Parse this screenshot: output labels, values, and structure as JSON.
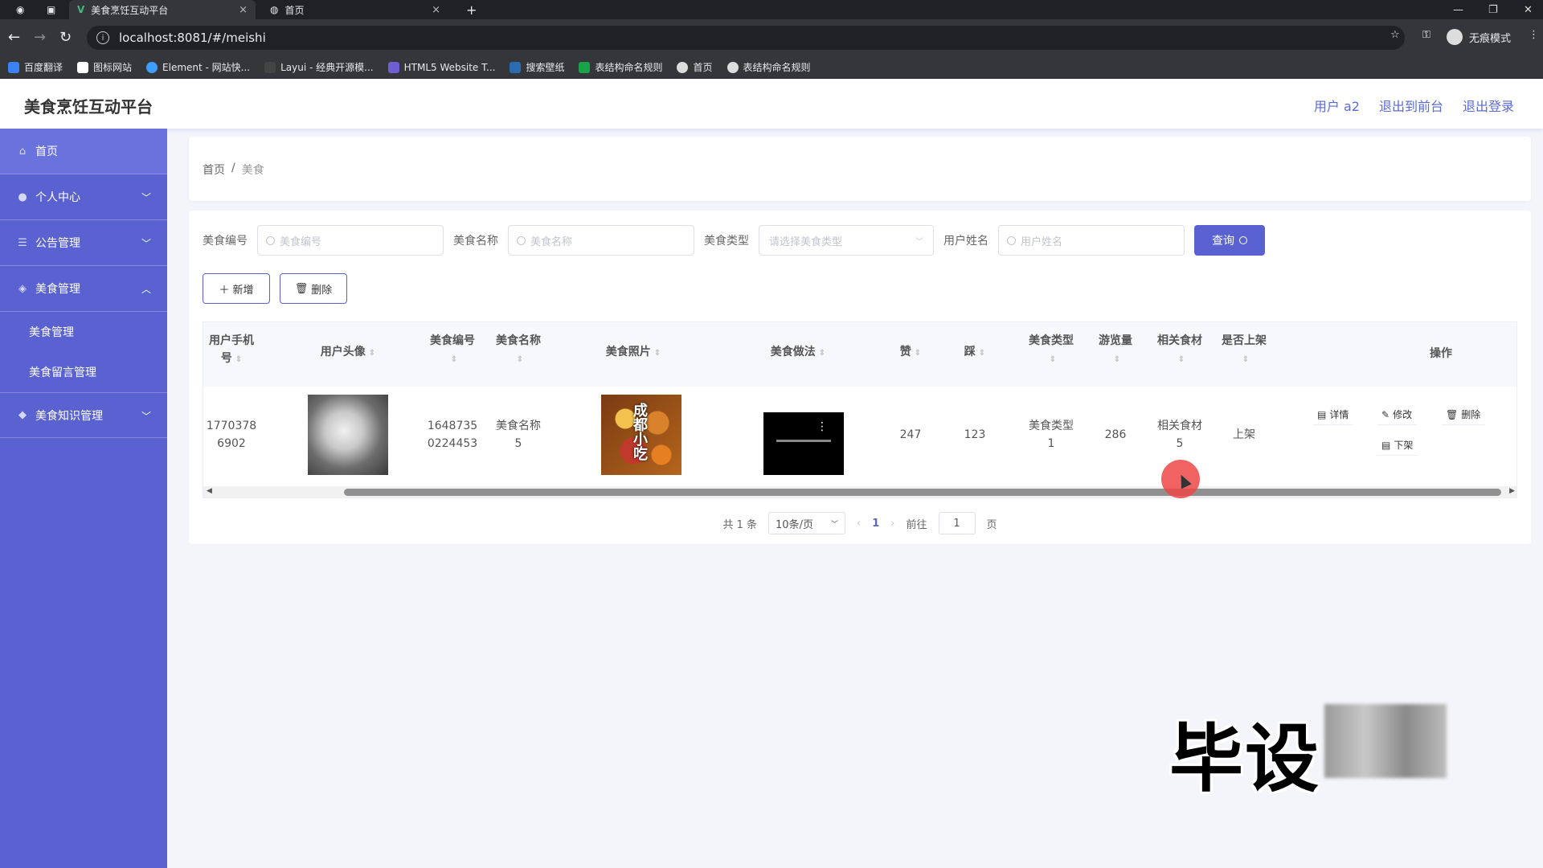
{
  "browser": {
    "tabs": [
      {
        "title": "美食烹饪互动平台",
        "active": true
      },
      {
        "title": "首页",
        "active": false
      }
    ],
    "url": "localhost:8081/#/meishi",
    "profile_label": "无痕模式",
    "bookmarks": [
      "百度翻译",
      "图标网站",
      "Element - 网站快...",
      "Layui - 经典开源模...",
      "HTML5 Website T...",
      "搜索壁纸",
      "表结构命名规则",
      "首页",
      "表结构命名规则"
    ]
  },
  "header": {
    "title": "美食烹饪互动平台",
    "user": "用户 a2",
    "back_front": "退出到前台",
    "logout": "退出登录"
  },
  "sidebar": {
    "items": [
      {
        "label": "首页",
        "icon": "home-icon"
      },
      {
        "label": "个人中心",
        "icon": "user-icon"
      },
      {
        "label": "公告管理",
        "icon": "list-icon"
      },
      {
        "label": "美食管理",
        "icon": "food-icon"
      },
      {
        "label": "美食知识管理",
        "icon": "knowledge-icon"
      }
    ],
    "sub_items": [
      "美食管理",
      "美食留言管理"
    ]
  },
  "breadcrumb": {
    "home": "首页",
    "sep": "/",
    "current": "美食"
  },
  "search": {
    "f1_label": "美食编号",
    "f1_placeholder": "美食编号",
    "f2_label": "美食名称",
    "f2_placeholder": "美食名称",
    "f3_label": "美食类型",
    "f3_placeholder": "请选择美食类型",
    "f4_label": "用户姓名",
    "f4_placeholder": "用户姓名",
    "query_label": "查询"
  },
  "actions": {
    "add": "新增",
    "delete": "删除"
  },
  "table": {
    "headers": {
      "phone_a": "用户手机",
      "phone_b": "号",
      "avatar": "用户头像",
      "code": "美食编号",
      "name": "美食名称",
      "photo": "美食照片",
      "method": "美食做法",
      "likes": "赞",
      "dislikes": "踩",
      "type": "美食类型",
      "views": "游览量",
      "ingredients": "相关食材",
      "listed": "是否上架",
      "ops": "操作"
    },
    "row": {
      "phone_a": "1770378",
      "phone_b": "6902",
      "code_a": "1648735",
      "code_b": "0224453",
      "name_a": "美食名称",
      "name_b": "5",
      "photo_text": "成都小吃",
      "likes": "247",
      "dislikes": "123",
      "type_a": "美食类型",
      "type_b": "1",
      "views": "286",
      "ingr_a": "相关食材",
      "ingr_b": "5",
      "listed": "上架"
    },
    "ops": {
      "detail": "详情",
      "edit": "修改",
      "delete": "删除",
      "unlist": "下架"
    }
  },
  "pagination": {
    "total": "共 1 条",
    "page_size": "10条/页",
    "current": "1",
    "goto_prefix": "前往",
    "goto_value": "1",
    "goto_suffix": "页"
  },
  "watermark": {
    "text": "毕设"
  }
}
